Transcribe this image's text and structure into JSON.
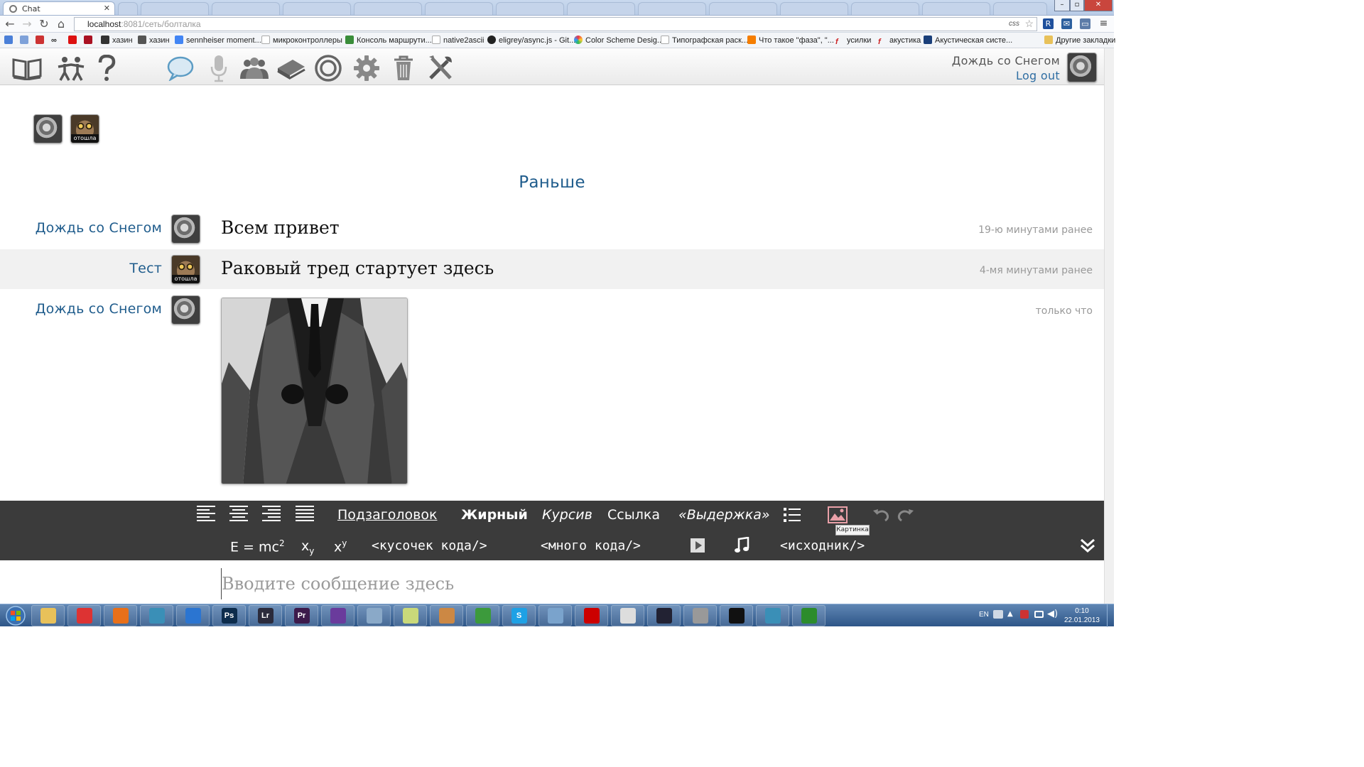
{
  "browser": {
    "tab_title": "Chat",
    "url_host": "localhost",
    "url_port": ":8081",
    "url_path": "/сеть/болталка",
    "css_badge": "css",
    "bookmarks": [
      {
        "label": "хазин",
        "color": "#333"
      },
      {
        "label": "хазин",
        "color": "#555"
      },
      {
        "label": "sennheiser moment...",
        "color": "#4285f4"
      },
      {
        "label": "микроконтроллеры",
        "color": "#aaa"
      },
      {
        "label": "Консоль маршрути...",
        "color": "#3a8d3a"
      },
      {
        "label": "native2ascii",
        "color": "#aaa"
      },
      {
        "label": "eligrey/async.js - Git...",
        "color": "#222"
      },
      {
        "label": "Color Scheme Desig...",
        "color": "#e34"
      },
      {
        "label": "Типографская раск...",
        "color": "#aaa"
      },
      {
        "label": "Что такое \"фаза\", \"...",
        "color": "#f57d00"
      },
      {
        "label": "усилки",
        "color": "#c22"
      },
      {
        "label": "акустика",
        "color": "#c22"
      },
      {
        "label": "Акустическая систе...",
        "color": "#1a3f7a"
      }
    ],
    "other_bookmarks": "Другие закладки"
  },
  "header": {
    "nav_icons": [
      "book-icon",
      "people-icon",
      "help-icon",
      "chat-icon",
      "microphone-icon",
      "group-icon",
      "library-icon",
      "target-icon",
      "settings-icon",
      "trash-icon",
      "tools-icon"
    ],
    "user_name": "Дождь со Снегом",
    "logout": "Log out"
  },
  "online_users": [
    "dog-avatar",
    "owl-avatar"
  ],
  "owl_caption": "отошла",
  "chat": {
    "earlier_link": "Раньше",
    "messages": [
      {
        "author": "Дождь со Снегом",
        "text": "Всем привет",
        "time": "19-ю минутами ранее"
      },
      {
        "author": "Тест",
        "text": "Раковый тред стартует здесь",
        "time": "4-мя минутами ранее"
      },
      {
        "author": "Дождь со Снегом",
        "text": "",
        "time": "только что"
      }
    ]
  },
  "editor": {
    "subheading": "Подзаголовок",
    "bold": "Жирный",
    "italic": "Курсив",
    "link": "Ссылка",
    "quote": "«Выдержка»",
    "formula": "E = mc",
    "formula_sup": "2",
    "subscript_base": "x",
    "subscript": "y",
    "superscript_base": "x",
    "superscript": "y",
    "inline_code": "<кусочек кода/>",
    "code_block": "<много кода/>",
    "source": "<исходник/>",
    "image_tooltip": "Картинка",
    "input_placeholder": "Вводите сообщение здесь"
  },
  "taskbar": {
    "lang": "EN",
    "time": "0:10",
    "date": "22.01.2013",
    "apps": [
      {
        "name": "explorer",
        "label": "",
        "color": "#e8c15a"
      },
      {
        "name": "chrome",
        "label": "",
        "color": "#d33"
      },
      {
        "name": "firefox",
        "label": "",
        "color": "#e8701a"
      },
      {
        "name": "network",
        "label": "",
        "color": "#3a8fb7"
      },
      {
        "name": "thunder",
        "label": "",
        "color": "#2b75d1"
      },
      {
        "name": "photoshop",
        "label": "Ps",
        "color": "#0d2c4c"
      },
      {
        "name": "lightroom",
        "label": "Lr",
        "color": "#2b2b3c"
      },
      {
        "name": "premiere",
        "label": "Pr",
        "color": "#3d1a4b"
      },
      {
        "name": "visual-studio",
        "label": "",
        "color": "#6a3b9c"
      },
      {
        "name": "app",
        "label": "",
        "color": "#8aa9c8"
      },
      {
        "name": "notepad",
        "label": "",
        "color": "#c9d97a"
      },
      {
        "name": "paint",
        "label": "",
        "color": "#c84"
      },
      {
        "name": "utorrent",
        "label": "",
        "color": "#3c9a3c"
      },
      {
        "name": "skype",
        "label": "S",
        "color": "#1ea1e5"
      },
      {
        "name": "remote",
        "label": "",
        "color": "#7aa3cc"
      },
      {
        "name": "acrobat",
        "label": "",
        "color": "#c00"
      },
      {
        "name": "alien",
        "label": "",
        "color": "#ddd"
      },
      {
        "name": "steam",
        "label": "",
        "color": "#223"
      },
      {
        "name": "media",
        "label": "",
        "color": "#999"
      },
      {
        "name": "cmd",
        "label": "",
        "color": "#111"
      },
      {
        "name": "network2",
        "label": "",
        "color": "#3a8fb7"
      },
      {
        "name": "leaf",
        "label": "",
        "color": "#2c8c2c"
      }
    ]
  }
}
